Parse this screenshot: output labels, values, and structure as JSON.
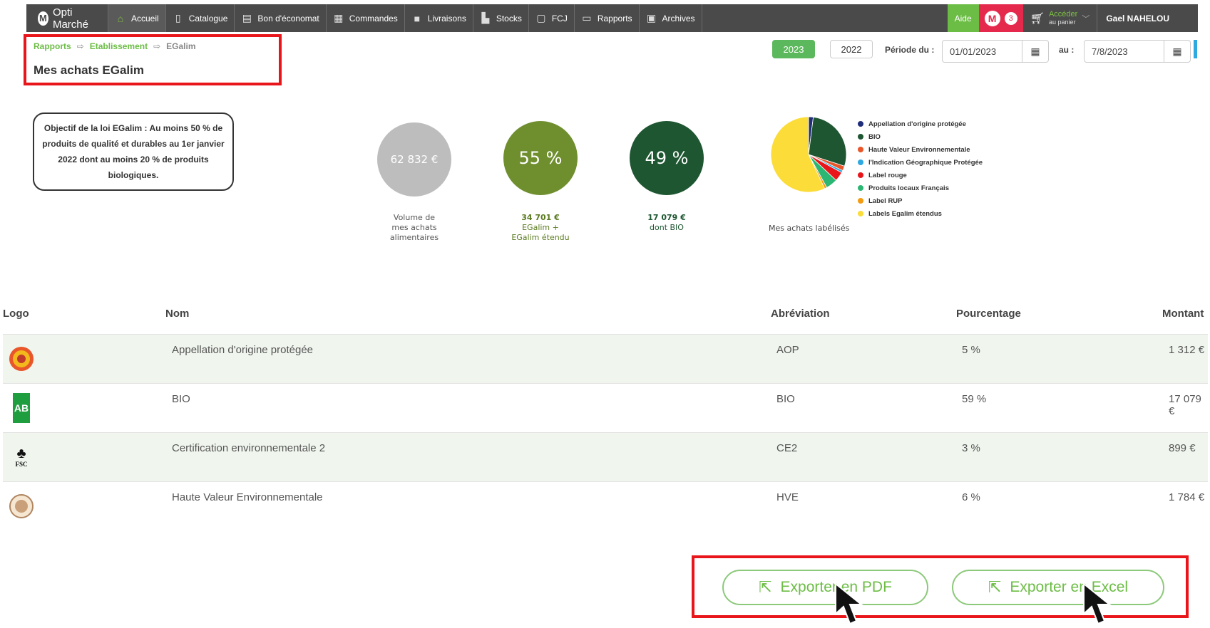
{
  "nav": {
    "brand": "Opti Marché",
    "brand_logo": "M",
    "items": [
      {
        "label": "Accueil",
        "icon": "home-icon"
      },
      {
        "label": "Catalogue",
        "icon": "book-icon"
      },
      {
        "label": "Bon d'économat",
        "icon": "document-icon"
      },
      {
        "label": "Commandes",
        "icon": "clipboard-icon"
      },
      {
        "label": "Livraisons",
        "icon": "truck-icon"
      },
      {
        "label": "Stocks",
        "icon": "forklift-icon"
      },
      {
        "label": "FCJ",
        "icon": "file-icon"
      },
      {
        "label": "Rapports",
        "icon": "report-icon"
      },
      {
        "label": "Archives",
        "icon": "archive-icon"
      }
    ],
    "aide": "Aide",
    "notif_logo": "M",
    "notif_count": "3",
    "cart_line1": "Accéder",
    "cart_line2": "au panier",
    "user": "Gael NAHELOU"
  },
  "breadcrumb": {
    "root": "Rapports",
    "mid": "Etablissement",
    "current": "EGalim"
  },
  "page_title": "Mes achats EGalim",
  "filters": {
    "year_active": "2023",
    "year_other": "2022",
    "period_from_label": "Période du :",
    "period_from": "01/01/2023",
    "period_to_label": "au :",
    "period_to": "7/8/2023"
  },
  "objective": "Objectif de la loi EGalim : Au moins 50 % de produits de qualité et durables au 1er janvier 2022 dont au moins 20 % de produits biologiques.",
  "stats": [
    {
      "value": "62 832 €",
      "caption": [
        "Volume de",
        "mes achats",
        "alimentaires"
      ],
      "color": "#bdbdbd",
      "caption_color": "#555555"
    },
    {
      "value": "55 %",
      "caption": [
        "34 701 €",
        "EGalim +",
        "EGalim étendu"
      ],
      "color": "#6f8f2f",
      "caption_color": "#5a7a1f"
    },
    {
      "value": "49 %",
      "caption": [
        "17 079 €",
        "dont BIO"
      ],
      "color": "#1e5631",
      "caption_color": "#1e5631"
    }
  ],
  "pie_caption": "Mes achats labélisés",
  "chart_data": {
    "type": "pie",
    "labels": [
      "Appellation d'origine protégée",
      "BIO",
      "Haute Valeur Environnementale",
      "l'Indication Géographique Protégée",
      "Label rouge",
      "Produits locaux Français",
      "Label RUP",
      "Labels Egalim étendus"
    ],
    "values": [
      2,
      28,
      2,
      1,
      4,
      5,
      1,
      57
    ],
    "colors": [
      "#1f2d7a",
      "#1e5631",
      "#e8562a",
      "#2ea8e0",
      "#e8151b",
      "#2bb673",
      "#f39c12",
      "#fbdc38"
    ],
    "legend_position": "right"
  },
  "table": {
    "headers": {
      "logo": "Logo",
      "nom": "Nom",
      "abbr": "Abréviation",
      "pct": "Pourcentage",
      "montant": "Montant"
    },
    "rows": [
      {
        "logo": "aop-logo",
        "nom": "Appellation d'origine protégée",
        "abbr": "AOP",
        "pct": "5 %",
        "montant": "1 312 €"
      },
      {
        "logo": "ab-logo",
        "logo_text": "AB",
        "nom": "BIO",
        "abbr": "BIO",
        "pct": "59 %",
        "montant": "17 079 €"
      },
      {
        "logo": "fsc-logo",
        "logo_text": "FSC",
        "nom": "Certification environnementale 2",
        "abbr": "CE2",
        "pct": "3 %",
        "montant": "899 €"
      },
      {
        "logo": "hve-logo",
        "nom": "Haute Valeur Environnementale",
        "abbr": "HVE",
        "pct": "6 %",
        "montant": "1 784 €"
      }
    ]
  },
  "export": {
    "pdf": "Exporter en PDF",
    "excel": "Exporter en Excel"
  }
}
